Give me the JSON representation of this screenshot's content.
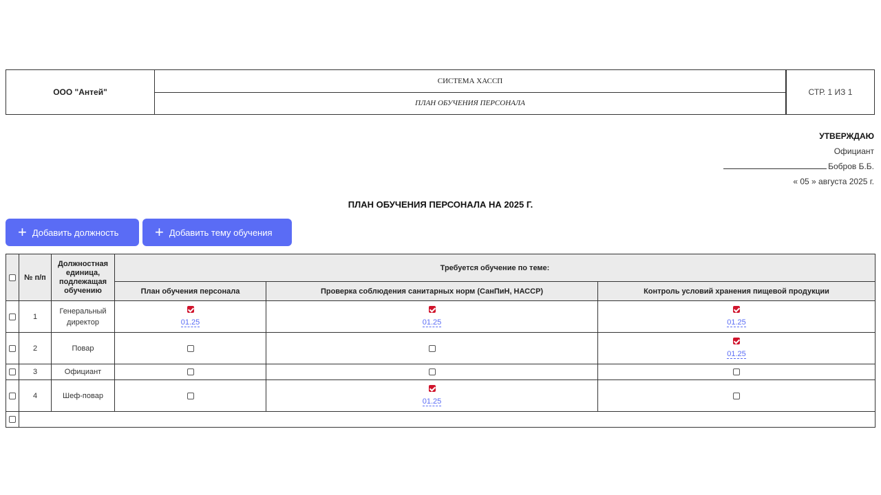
{
  "header": {
    "org": "ООО \"Антей\"",
    "system": "СИСТЕМА ХАССП",
    "doc": "ПЛАН ОБУЧЕНИЯ ПЕРСОНАЛА",
    "page": "СТР. 1 ИЗ 1"
  },
  "approval": {
    "title": "УТВЕРЖДАЮ",
    "position": "Официант",
    "name": "Бобров Б.Б.",
    "date": "« 05 » августа 2025 г."
  },
  "plan_title": "ПЛАН ОБУЧЕНИЯ ПЕРСОНАЛА НА 2025 Г.",
  "buttons": {
    "add_position": "Добавить должность",
    "add_topic": "Добавить тему обучения"
  },
  "table": {
    "col_num": "№ п/п",
    "col_position": "Должностная единица, подлежащая обучению",
    "col_group": "Требуется обучение по теме:",
    "topics": [
      "План обучения персонала",
      "Проверка соблюдения санитарных норм (СанПиН, НАССР)",
      "Контроль условий хранения пищевой продукции"
    ],
    "rows": [
      {
        "num": "1",
        "position": "Генеральный директор",
        "cells": [
          {
            "checked": true,
            "date": "01.25"
          },
          {
            "checked": true,
            "date": "01.25"
          },
          {
            "checked": true,
            "date": "01.25"
          }
        ]
      },
      {
        "num": "2",
        "position": "Повар",
        "cells": [
          {
            "checked": false,
            "date": ""
          },
          {
            "checked": false,
            "date": ""
          },
          {
            "checked": true,
            "date": "01.25"
          }
        ]
      },
      {
        "num": "3",
        "position": "Официант",
        "cells": [
          {
            "checked": false,
            "date": ""
          },
          {
            "checked": false,
            "date": ""
          },
          {
            "checked": false,
            "date": ""
          }
        ]
      },
      {
        "num": "4",
        "position": "Шеф-повар",
        "cells": [
          {
            "checked": false,
            "date": ""
          },
          {
            "checked": true,
            "date": "01.25"
          },
          {
            "checked": false,
            "date": ""
          }
        ]
      }
    ]
  },
  "colors": {
    "accent": "#5a6cf5",
    "check": "#d0142c"
  }
}
